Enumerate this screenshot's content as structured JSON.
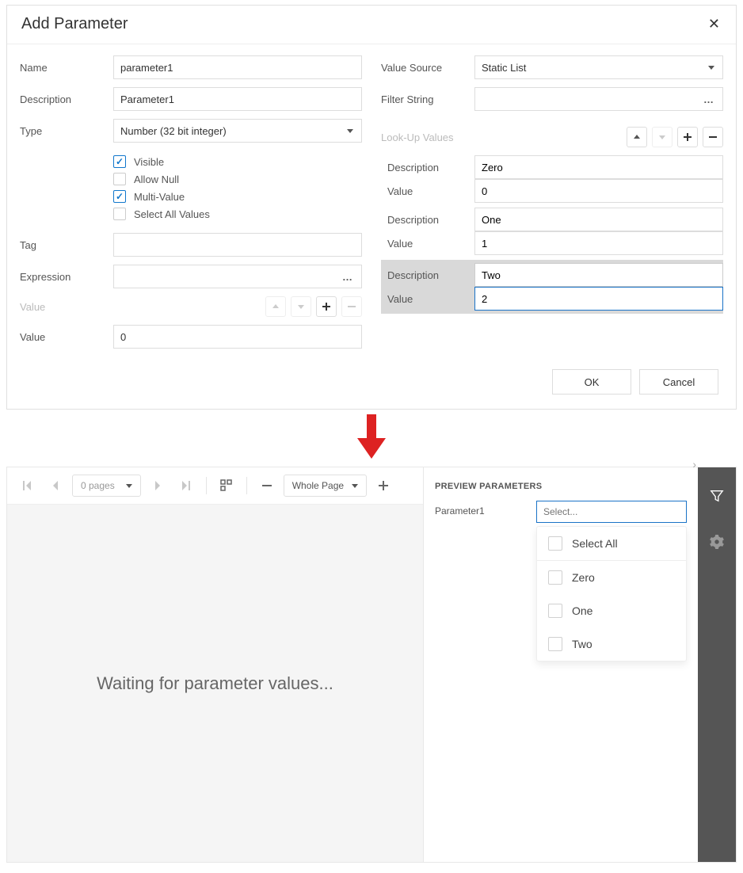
{
  "dialog": {
    "title": "Add Parameter",
    "labels": {
      "name": "Name",
      "description": "Description",
      "type": "Type",
      "visible": "Visible",
      "allow_null": "Allow Null",
      "multi_value": "Multi-Value",
      "select_all": "Select All Values",
      "tag": "Tag",
      "expression": "Expression",
      "value_hdr": "Value",
      "value": "Value",
      "value_source": "Value Source",
      "filter_string": "Filter String",
      "lookup": "Look-Up Values",
      "lu_desc": "Description",
      "lu_val": "Value"
    },
    "fields": {
      "name": "parameter1",
      "description": "Parameter1",
      "type": "Number (32 bit integer)",
      "tag": "",
      "expression": "",
      "value0": "0",
      "value_source": "Static List",
      "filter_string": ""
    },
    "lookup": [
      {
        "desc": "Zero",
        "val": "0"
      },
      {
        "desc": "One",
        "val": "1"
      },
      {
        "desc": "Two",
        "val": "2"
      }
    ],
    "buttons": {
      "ok": "OK",
      "cancel": "Cancel"
    }
  },
  "preview": {
    "pages": "0 pages",
    "zoom": "Whole Page",
    "waiting": "Waiting for parameter values...",
    "panel_title": "PREVIEW PARAMETERS",
    "param_label": "Parameter1",
    "select_placeholder": "Select...",
    "options": {
      "select_all": "Select All",
      "o0": "Zero",
      "o1": "One",
      "o2": "Two"
    }
  }
}
